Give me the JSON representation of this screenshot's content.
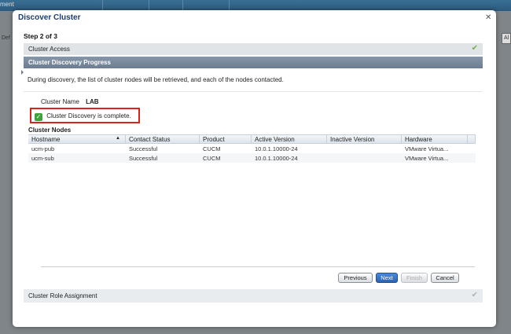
{
  "background": {
    "title": "ment",
    "left_label": "Def",
    "right_label": "Al"
  },
  "modal": {
    "title": "Discover Cluster",
    "step": "Step 2 of 3",
    "sections": {
      "cluster_access": "Cluster Access",
      "progress": "Cluster Discovery Progress",
      "role_assignment": "Cluster Role Assignment"
    },
    "description": "During discovery, the list of cluster nodes will be retrieved, and each of the nodes contacted.",
    "cluster_name_label": "Cluster Name",
    "cluster_name_value": "LAB",
    "status_message": "Cluster Discovery is complete.",
    "nodes_title": "Cluster Nodes",
    "table": {
      "columns": [
        "Hostname",
        "Contact Status",
        "Product",
        "Active Version",
        "Inactive Version",
        "Hardware"
      ],
      "rows": [
        [
          "ucm-pub",
          "Successful",
          "CUCM",
          "10.0.1.10000-24",
          "",
          "VMware Virtua..."
        ],
        [
          "ucm-sub",
          "Successful",
          "CUCM",
          "10.0.1.10000-24",
          "",
          "VMware Virtua..."
        ]
      ]
    },
    "buttons": {
      "previous": "Previous",
      "next": "Next",
      "finish": "Finish",
      "cancel": "Cancel"
    }
  },
  "colors": {
    "accent": "#2a63b3",
    "highlight_border": "#d9231d",
    "success": "#3fa33c"
  }
}
